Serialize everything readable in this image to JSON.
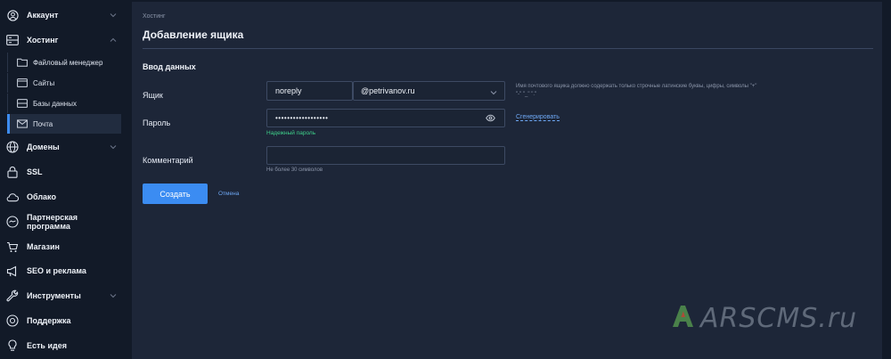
{
  "sidebar": {
    "items": [
      {
        "label": "Аккаунт",
        "icon": "user-circle-icon"
      },
      {
        "label": "Хостинг",
        "icon": "server-icon"
      },
      {
        "label": "Файловый менеджер",
        "icon": "folder-icon"
      },
      {
        "label": "Сайты",
        "icon": "browser-window-icon"
      },
      {
        "label": "Базы данных",
        "icon": "database-icon"
      },
      {
        "label": "Почта",
        "icon": "mail-icon"
      },
      {
        "label": "Домены",
        "icon": "globe-icon"
      },
      {
        "label": "SSL",
        "icon": "lock-icon"
      },
      {
        "label": "Облако",
        "icon": "cloud-icon"
      },
      {
        "label": "Партнерская программа",
        "icon": "handshake-icon"
      },
      {
        "label": "Магазин",
        "icon": "cart-icon"
      },
      {
        "label": "SEO и реклама",
        "icon": "megaphone-icon"
      },
      {
        "label": "Инструменты",
        "icon": "wrench-icon"
      },
      {
        "label": "Поддержка",
        "icon": "support-icon"
      },
      {
        "label": "Есть идея",
        "icon": "lightbulb-icon"
      }
    ],
    "active_item": "Почта"
  },
  "main": {
    "breadcrumb": "Хостинг",
    "title": "Добавление ящика",
    "section_title": "Ввод данных",
    "mailbox": {
      "label": "Ящик",
      "value": "noreply",
      "domain": "@petrivanov.ru",
      "hint": "Имя почтового ящика должно содержать только строчные латинские буквы, цифры, символы \"+\" \"-\" \"_\" \".\""
    },
    "password": {
      "label": "Пароль",
      "value": "••••••••••••••••••",
      "strength": "Надежный пароль",
      "generate_label": "Сгенерировать"
    },
    "comment": {
      "label": "Комментарий",
      "value": "",
      "hint": "Не более 30 символов"
    },
    "submit_label": "Создать",
    "cancel_label": "Отмена"
  },
  "watermark": {
    "text": "ARSCMS.ru"
  },
  "colors": {
    "accent": "#3b8cf2",
    "success": "#3fd08a",
    "link": "#6ea8f5",
    "panel": "#1d2638",
    "sidebar": "#121a28"
  }
}
